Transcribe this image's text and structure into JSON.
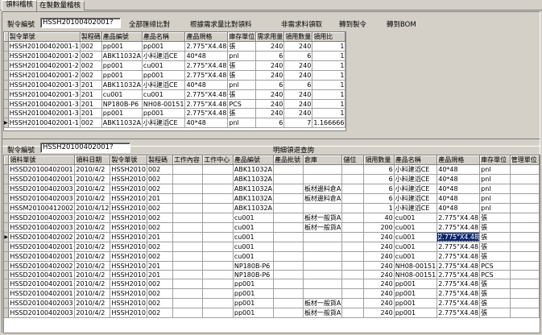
{
  "tabs": [
    "領料稽核",
    "在製數量稽核"
  ],
  "top": {
    "order_label": "製令編號",
    "order_value": "HSSH20100402001?",
    "buttons": [
      "全部匯總比對",
      "根據需求量比對領料",
      "非需求料領取",
      "轉到製令",
      "轉到BOM"
    ]
  },
  "grid1": {
    "columns": [
      "製令單號",
      "製程碼",
      "產品編號",
      "產品名稱",
      "產品規格",
      "庫存單位",
      "需求用量",
      "領用數量",
      "領用比"
    ],
    "rows": [
      [
        "HSSH20100402001-1",
        "002",
        "pp001",
        "pp001",
        "2.775\"X4.48",
        "張",
        "240",
        "240",
        "1"
      ],
      [
        "HSSH20100402001-2",
        "002",
        "ABK11032A",
        "小料建滔CE",
        "40*48",
        "pnl",
        "6",
        "6",
        "1"
      ],
      [
        "HSSH20100402001-2",
        "002",
        "pp001",
        "cu001",
        "2.775\"X4.48",
        "張",
        "240",
        "240",
        "1"
      ],
      [
        "HSSH20100402001-2",
        "002",
        "pp001",
        "pp001",
        "2.775\"X4.48",
        "張",
        "240",
        "240",
        "1"
      ],
      [
        "HSSH20100402001-3",
        "201",
        "ABK11032A",
        "小料建滔CE",
        "40*48",
        "pnl",
        "6",
        "6",
        "1"
      ],
      [
        "HSSH20100402001-3",
        "201",
        "cu001",
        "cu001",
        "2.775\"X4.48",
        "張",
        "240",
        "240",
        "1"
      ],
      [
        "HSSH20100402001-3",
        "201",
        "NP180B-P6",
        "NH08-00151",
        "2.775\"X4.48",
        "PCS",
        "240",
        "240",
        "1"
      ],
      [
        "HSSH20100402001-3",
        "201",
        "pp001",
        "pp001",
        "2.775\"X4.48",
        "張",
        "240",
        "240",
        "1"
      ],
      [
        "HSSH20100402001-1",
        "002",
        "ABK11032A",
        "小料建滔CE",
        "40*48",
        "pnl",
        "6",
        "7",
        "1.166666"
      ]
    ]
  },
  "bottom": {
    "order_label": "製令編號",
    "order_value": "HSSH20100402001?",
    "query_label": "明細領退查詢"
  },
  "grid2": {
    "columns": [
      "領料單號",
      "領料日期",
      "製令單號",
      "製程碼",
      "工作內容",
      "工作中心",
      "產品編號",
      "產品批號",
      "倉庫",
      "儲位",
      "領用數量",
      "產品名稱",
      "產品規格",
      "庫存單位",
      "管理單位"
    ],
    "rows": [
      [
        "HSSD20100402001",
        "2010/4/2",
        "HSSH2010",
        "002",
        "",
        "",
        "ABK11032A",
        "",
        "",
        "",
        "6",
        "小料建滔CE",
        "40*48",
        "pnl",
        ""
      ],
      [
        "HSSD20100402001",
        "2010/4/2",
        "HSSH2010",
        "002",
        "",
        "",
        "ABK11032A",
        "",
        "",
        "",
        "6",
        "小料建滔CE",
        "40*48",
        "pnl",
        ""
      ],
      [
        "HSSD20100402003",
        "2010/4/2",
        "HSSH2010",
        "002",
        "",
        "",
        "ABK11032A",
        "",
        "板材邊料倉A",
        "",
        "6",
        "小料建滔CE",
        "40*48",
        "pnl",
        ""
      ],
      [
        "HSSD20100402003",
        "2010/4/2",
        "HSSH2010",
        "201",
        "",
        "",
        "ABK11032A",
        "",
        "板材邊料倉A",
        "",
        "6",
        "小料建滔CE",
        "40*48",
        "pnl",
        ""
      ],
      [
        "HSSM20100412002",
        "2010/4/12",
        "HSSH2010",
        "002",
        "",
        "",
        "ABK11032A",
        "",
        "",
        "",
        "1",
        "小料建滔CE",
        "40*48",
        "pnl",
        ""
      ],
      [
        "HSSD20100402003",
        "2010/4/2",
        "HSSH2010",
        "002",
        "",
        "",
        "cu001",
        "",
        "板材一般貨A",
        "",
        "40",
        "cu001",
        "2.775\"X4.48",
        "張",
        ""
      ],
      [
        "HSSD20100402003",
        "2010/4/2",
        "HSSH2010",
        "002",
        "",
        "",
        "cu001",
        "",
        "板材一般貨A",
        "",
        "200",
        "cu001",
        "2.775\"X4.48",
        "張",
        ""
      ],
      [
        "HSSD20100402002",
        "2010/4/2",
        "HSSH2010",
        "201",
        "",
        "",
        "cu001",
        "",
        "",
        "",
        "240",
        "cu001",
        "2.775\"X4.48",
        "張",
        ""
      ],
      [
        "HSSD20100402001",
        "2010/4/2",
        "HSSH2010",
        "002",
        "",
        "",
        "cu001",
        "",
        "",
        "",
        "240",
        "cu001",
        "2.775\"X4.48",
        "張",
        ""
      ],
      [
        "HSSD20100402001",
        "2010/4/2",
        "HSSH2010",
        "002",
        "",
        "",
        "cu001",
        "",
        "",
        "",
        "240",
        "cu001",
        "2.775\"X4.48",
        "張",
        ""
      ],
      [
        "HSSD20100402002",
        "2010/4/2",
        "HSSH2010",
        "201",
        "",
        "",
        "NP180B-P6",
        "",
        "",
        "",
        "240",
        "NH08-00151",
        "2.775\"X4.48",
        "PCS",
        ""
      ],
      [
        "HSSD20100402001",
        "2010/4/2",
        "HSSH2010",
        "201",
        "",
        "",
        "NP180B-P6",
        "",
        "",
        "",
        "240",
        "NH08-00151",
        "2.775\"X4.48",
        "PCS",
        ""
      ],
      [
        "HSSD20100402001",
        "2010/4/2",
        "HSSH2010",
        "002",
        "",
        "",
        "pp001",
        "",
        "",
        "",
        "240",
        "pp001",
        "2.775\"X4.48",
        "張",
        ""
      ],
      [
        "HSSD20100402001",
        "2010/4/2",
        "HSSH2010",
        "002",
        "",
        "",
        "pp001",
        "",
        "",
        "",
        "240",
        "pp001",
        "2.775\"X4.48",
        "張",
        ""
      ],
      [
        "HSSD20100402003",
        "2010/4/2",
        "HSSH2010",
        "002",
        "",
        "",
        "pp001",
        "",
        "板材一般貨A",
        "",
        "240",
        "pp001",
        "2.775\"X4.48",
        "張",
        ""
      ],
      [
        "HSSD20100402003",
        "2010/4/2",
        "HSSH2010",
        "002",
        "",
        "",
        "pp001",
        "",
        "板材一般貨A",
        "",
        "240",
        "pp001",
        "2.775\"X4.48",
        "張",
        ""
      ]
    ]
  }
}
